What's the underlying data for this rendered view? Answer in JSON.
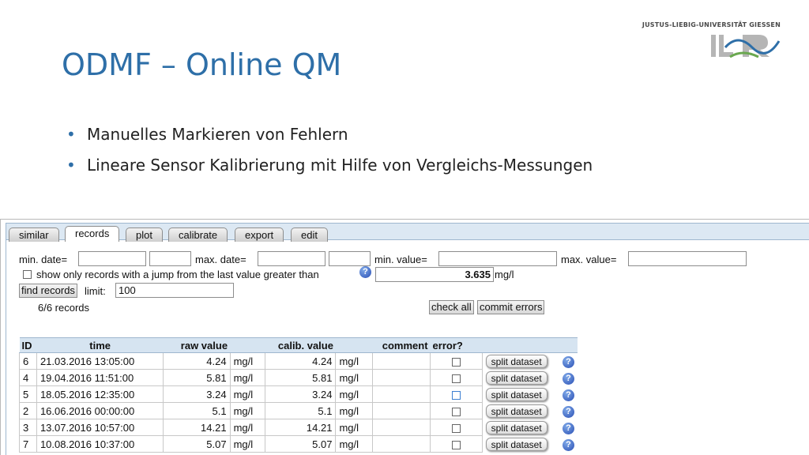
{
  "slide": {
    "university": "JUSTUS-LIEBIG-UNIVERSITÄT GIESSEN",
    "logo_text": "ILR",
    "title": "ODMF – Online QM",
    "bullets": [
      "Manuelles Markieren von Fehlern",
      "Lineare Sensor Kalibrierung mit Hilfe von Vergleichs-Messungen"
    ],
    "accent_color": "#2e6fa8"
  },
  "app": {
    "tabs": [
      "similar",
      "records",
      "plot",
      "calibrate",
      "export",
      "edit"
    ],
    "active_tab": "records",
    "filters": {
      "min_date_label": "min. date=",
      "max_date_label": "max. date=",
      "min_value_label": "min. value=",
      "max_value_label": "max. value=",
      "min_date": "",
      "min_time": "",
      "max_date": "",
      "max_time": "",
      "min_value": "",
      "max_value": "",
      "jump_label": "show only records with a jump from the last value greater than",
      "jump_checked": false,
      "jump_value": "3.635",
      "jump_unit": "mg/l",
      "find_button": "find records",
      "limit_label": "limit:",
      "limit_value": "100"
    },
    "record_count": "6/6 records",
    "check_all_button": "check all",
    "commit_errors_button": "commit errors",
    "table": {
      "headers": {
        "id": "ID",
        "time": "time",
        "raw": "raw value",
        "calib": "calib. value",
        "comment": "comment",
        "error": "error?"
      },
      "rows": [
        {
          "id": "6",
          "time": "21.03.2016 13:05:00",
          "raw": "4.24",
          "raw_unit": "mg/l",
          "calib": "4.24",
          "calib_unit": "mg/l",
          "comment": "",
          "error": false,
          "split": "split dataset"
        },
        {
          "id": "4",
          "time": "19.04.2016 11:51:00",
          "raw": "5.81",
          "raw_unit": "mg/l",
          "calib": "5.81",
          "calib_unit": "mg/l",
          "comment": "",
          "error": false,
          "split": "split dataset"
        },
        {
          "id": "5",
          "time": "18.05.2016 12:35:00",
          "raw": "3.24",
          "raw_unit": "mg/l",
          "calib": "3.24",
          "calib_unit": "mg/l",
          "comment": "",
          "error": false,
          "split": "split dataset"
        },
        {
          "id": "2",
          "time": "16.06.2016 00:00:00",
          "raw": "5.1",
          "raw_unit": "mg/l",
          "calib": "5.1",
          "calib_unit": "mg/l",
          "comment": "",
          "error": false,
          "split": "split dataset"
        },
        {
          "id": "3",
          "time": "13.07.2016 10:57:00",
          "raw": "14.21",
          "raw_unit": "mg/l",
          "calib": "14.21",
          "calib_unit": "mg/l",
          "comment": "",
          "error": false,
          "split": "split dataset"
        },
        {
          "id": "7",
          "time": "10.08.2016 10:37:00",
          "raw": "5.07",
          "raw_unit": "mg/l",
          "calib": "5.07",
          "calib_unit": "mg/l",
          "comment": "",
          "error": false,
          "split": "split dataset"
        }
      ]
    },
    "icons": {
      "help": "help-icon",
      "checkbox": "checkbox-icon"
    }
  }
}
